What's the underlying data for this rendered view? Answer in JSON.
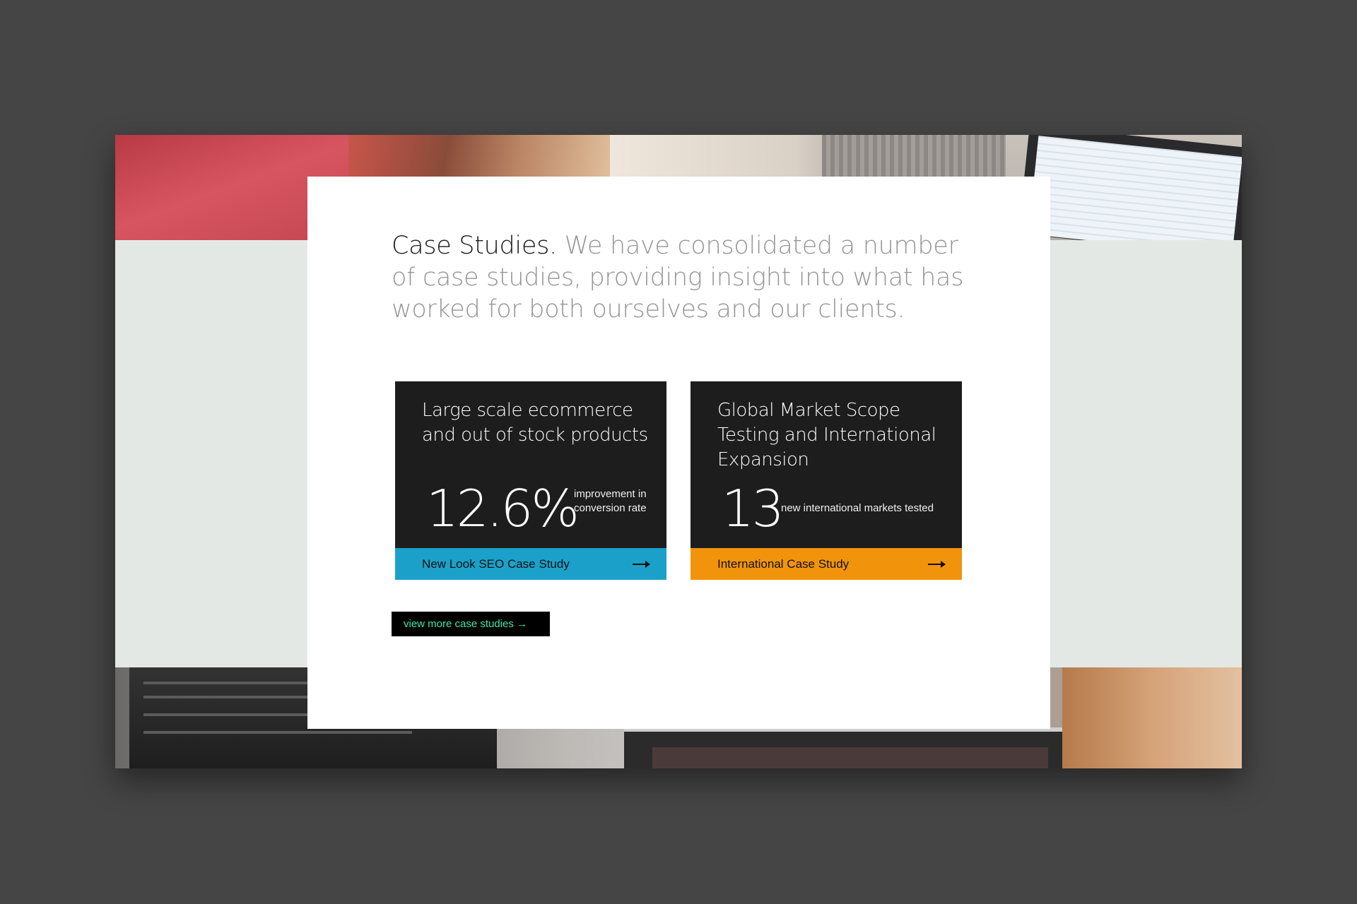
{
  "intro": {
    "lead": "Case Studies.",
    "text": " We have consolidated a number of case studies, providing insight into what has worked for both ourselves and our clients."
  },
  "cards": [
    {
      "title": "Large scale ecommerce and out of stock products",
      "stat": "12.6%",
      "description": "improvement in conversion rate",
      "link_label": "New Look SEO Case Study",
      "accent": "#1ba1c9",
      "icon": "arrow-right-icon"
    },
    {
      "title": "Global Market Scope Testing and International Expansion",
      "stat": "13",
      "description": "new international markets tested",
      "link_label": "International Case Study",
      "accent": "#f2930c",
      "icon": "arrow-right-icon"
    }
  ],
  "more_button": {
    "label": "view more case studies →",
    "text_color": "#3ee7b0"
  },
  "colors": {
    "background": "#454545",
    "panel": "#ffffff",
    "card": "#1d1d1d"
  }
}
